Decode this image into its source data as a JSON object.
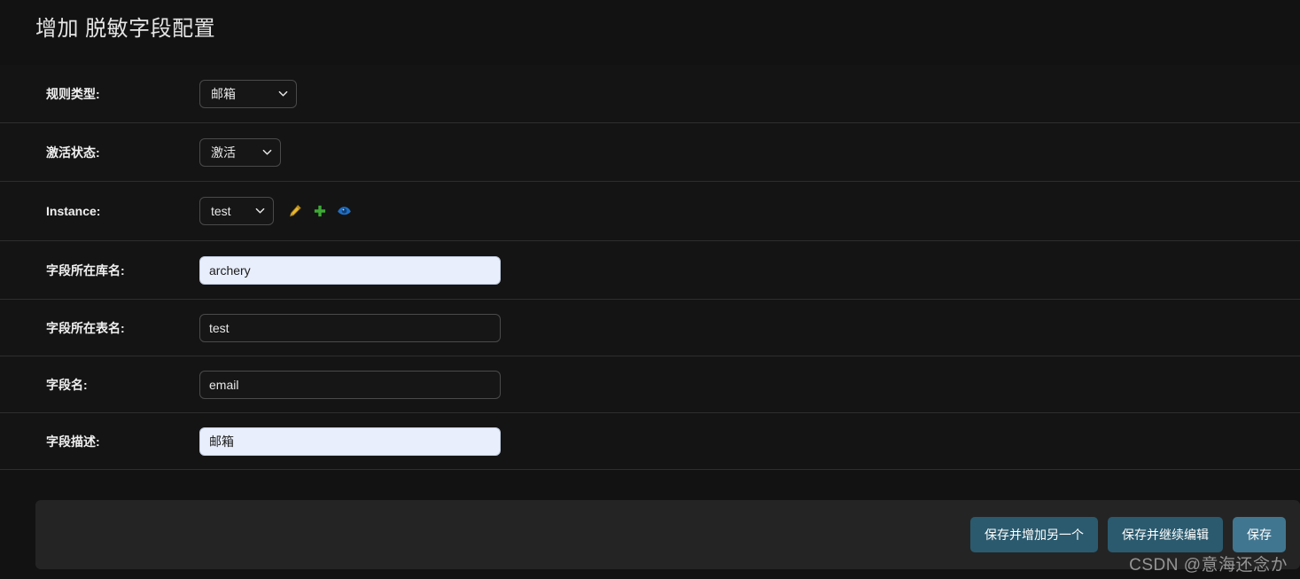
{
  "page": {
    "title": "增加 脱敏字段配置",
    "background_color": "#121212",
    "row_background_color": "#141414",
    "divider_color": "#2e2e2e"
  },
  "form": {
    "rows": [
      {
        "label": "规则类型:",
        "control": "select",
        "value": "邮箱"
      },
      {
        "label": "激活状态:",
        "control": "select",
        "value": "激活"
      },
      {
        "label": "Instance:",
        "control": "select-with-actions",
        "value": "test",
        "actions": [
          {
            "name": "edit-pencil-icon",
            "title": "修改",
            "color": "#e8b931"
          },
          {
            "name": "add-plus-icon",
            "title": "增加",
            "color": "#3daa35"
          },
          {
            "name": "view-eye-icon",
            "title": "查看",
            "color": "#1f6fc4"
          }
        ]
      },
      {
        "label": "字段所在库名:",
        "control": "text",
        "value": "archery",
        "placeholder": "",
        "autofilled": true
      },
      {
        "label": "字段所在表名:",
        "control": "text",
        "value": "test",
        "placeholder": "",
        "autofilled": false
      },
      {
        "label": "字段名:",
        "control": "text",
        "value": "email",
        "placeholder": "",
        "autofilled": false
      },
      {
        "label": "字段描述:",
        "control": "text",
        "value": "邮箱",
        "placeholder": "",
        "autofilled": true
      }
    ]
  },
  "submit_bar": {
    "background_color": "#242424",
    "buttons": [
      {
        "label": "保存并增加另一个",
        "style": "alt",
        "color": "#2b5a6e"
      },
      {
        "label": "保存并继续编辑",
        "style": "alt",
        "color": "#2b5a6e"
      },
      {
        "label": "保存",
        "style": "primary",
        "color": "#417690"
      }
    ]
  },
  "watermark": {
    "text": "CSDN @意海还念か"
  }
}
